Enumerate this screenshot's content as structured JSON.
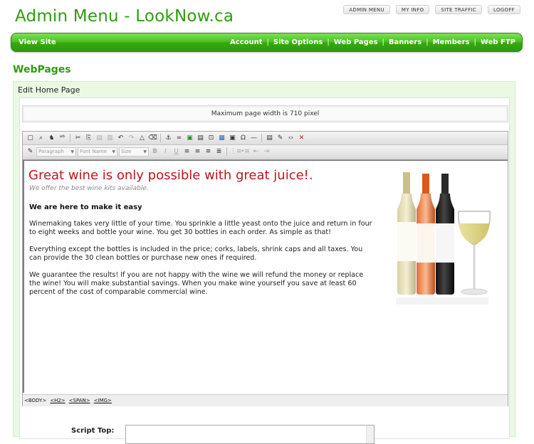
{
  "header": {
    "title": "Admin Menu - LookNow.ca",
    "top_links": [
      "ADMIN MENU",
      "MY INFO",
      "SITE TRAFFIC",
      "LOGOFF"
    ]
  },
  "nav": {
    "view_site": "View Site",
    "items": [
      "Account",
      "Site Options",
      "Web Pages",
      "Banners",
      "Members",
      "Web FTP"
    ]
  },
  "section": {
    "title": "WebPages"
  },
  "panel": {
    "title": "Edit Home Page",
    "width_note": "Maximum page width is 710 pixel"
  },
  "toolbar": {
    "paragraph": "Paragraph",
    "font_name": "Font Name",
    "size": "Size"
  },
  "content": {
    "headline": "Great wine is only possible with great juice!.",
    "subline": "We offer the best wine kits available.",
    "subhead": "We are here to make it easy",
    "p1": "Winemaking takes very little of your time. You sprinkle a little yeast onto the juice and return in four to eight weeks and bottle your wine. You get 30 bottles in each order. As simple as that!",
    "p2": "Everything except the bottles is included in the price; corks, labels, shrink caps and all taxes. You can provide the 30 clean bottles or purchase new ones if required.",
    "p3": "We guarantee the results! If you are not happy with the wine we will refund the money or replace the wine! You will make substantial savings. When you make wine yourself you save at least 60 percent of the cost of comparable commercial wine."
  },
  "pathbar": [
    "<BODY>",
    "<H2>",
    "<SPAN>",
    "<IMG>"
  ],
  "script_top": {
    "label": "Script Top:",
    "value": ""
  },
  "colors": {
    "brand_green": "#2e9d10",
    "headline_red": "#c0141a"
  }
}
